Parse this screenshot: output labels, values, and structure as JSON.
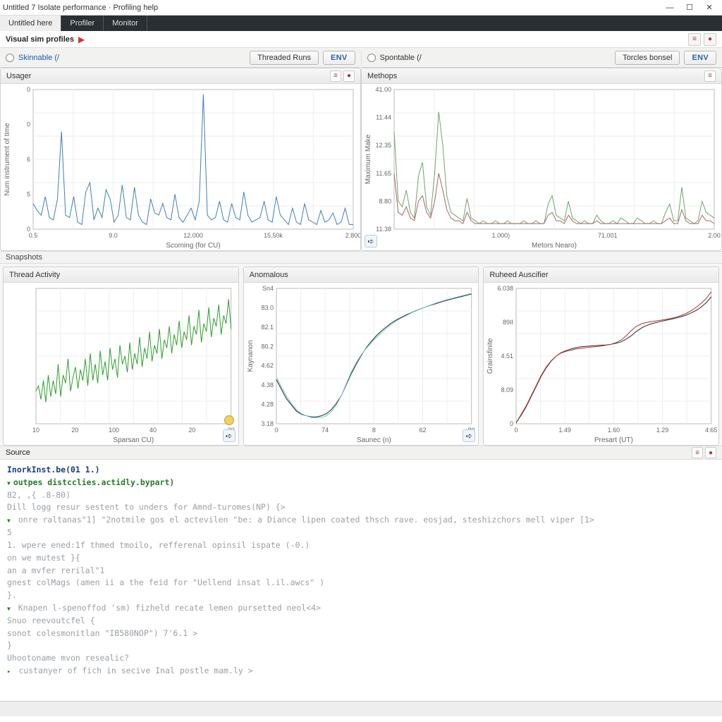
{
  "window": {
    "title": "Untitled 7 Isolate performance · Profiling help"
  },
  "tabs": [
    {
      "label": "Untitled here",
      "active": true
    },
    {
      "label": "Profiler",
      "active": false
    },
    {
      "label": "Monitor",
      "active": false
    }
  ],
  "subheader": {
    "title": "Visual sim profiles"
  },
  "controls": {
    "left": {
      "radio_label": "Skinnable (/",
      "btn1": "Threaded Runs",
      "btn2": "ENV"
    },
    "right": {
      "radio_label": "Spontable (/",
      "btn1": "Torcles bonsel",
      "btn2": "ENV"
    }
  },
  "panel_titles": {
    "p1": "Usager",
    "p2": "Methops",
    "mid_label": "Snapshots",
    "p3": "Thread Activity",
    "p4": "Anomalous",
    "p5": "Ruheed Auscifier"
  },
  "source_bar": {
    "label": "Source"
  },
  "console_lines": [
    {
      "cls": "fn",
      "text": "InorkInst.be(01 1.)"
    },
    {
      "cls": "kw chevron",
      "text": "outpes distcclies.actidly.bypart)"
    },
    {
      "cls": "cm",
      "text": "   82,              ,{ .8-80)"
    },
    {
      "cls": "cm",
      "text": "   Dill logg resur sestent to unders for Amnd-turomes(NP) {>"
    },
    {
      "cls": "cm chevron",
      "text": " onre raltanas\"1] \"2notmile gos el actevilen \"be: a Diance lipen coated thsch rave. eosjad, steshizchors mell viper [1>"
    },
    {
      "cls": "cm",
      "text": "   5"
    },
    {
      "cls": "cm",
      "text": "   1. wpere ened:1f thmed tmoilo, refferenal opinsil ispate (-0.)"
    },
    {
      "cls": "cm",
      "text": "      on we mutest }{"
    },
    {
      "cls": "cm",
      "text": "      an a mvfer rerilal\"1"
    },
    {
      "cls": "cm",
      "text": "         gnest colMags (amen ii a the feid for \"Uellend insat l.il.awcs\" )"
    },
    {
      "cls": "cm",
      "text": "   }."
    },
    {
      "cls": "cm chevron",
      "text": " Knapen l-spenoffod 'sm) fizheld recate lemen pursetted neol<4>"
    },
    {
      "cls": "cm",
      "text": "   Snuo reevoutcfel {"
    },
    {
      "cls": "cm",
      "text": "   sonot colesmonitlan \"IB580NOP\") 7'6.1 >"
    },
    {
      "cls": "cm",
      "text": "   }"
    },
    {
      "cls": "cm",
      "text": "   Uhootoname mvon resealic?"
    },
    {
      "cls": "cm chevronr",
      "text": " custanyer of fich in secive Inal postle mam.ly >"
    }
  ],
  "chart_data": [
    {
      "id": "p1",
      "type": "line",
      "title": "Usager",
      "xlabel": "Scoming (for CU)",
      "ylabel": "Num instrument of time",
      "xticks": [
        "0.5",
        "9.0",
        "12.000",
        "15.50k",
        "2.800"
      ],
      "yticks": [
        "0",
        "5",
        "6",
        "0",
        "0"
      ],
      "series": [
        {
          "name": "trace-blue",
          "color": "#3f7fbf",
          "values": [
            1.1,
            0.8,
            0.6,
            1.4,
            0.5,
            0.4,
            1.3,
            4.2,
            0.6,
            0.5,
            1.4,
            0.3,
            0.2,
            1.6,
            2.0,
            0.4,
            0.9,
            0.5,
            1.7,
            1.3,
            0.3,
            0.6,
            1.9,
            0.5,
            0.4,
            1.8,
            0.6,
            0.3,
            0.2,
            1.3,
            0.7,
            0.6,
            1.1,
            0.5,
            0.4,
            1.5,
            0.5,
            0.3,
            0.6,
            0.9,
            0.4,
            1.2,
            5.8,
            0.6,
            0.4,
            0.5,
            1.2,
            0.4,
            0.3,
            1.1,
            0.5,
            0.4,
            1.6,
            0.6,
            0.3,
            0.4,
            0.5,
            1.2,
            0.4,
            0.3,
            1.4,
            0.6,
            0.4,
            0.2,
            0.9,
            0.3,
            0.2,
            1.1,
            0.4,
            0.3,
            0.2,
            0.8,
            0.3,
            0.4,
            0.7,
            0.2,
            0.3,
            0.9,
            0.2,
            0.2
          ]
        }
      ],
      "ylim": [
        0,
        6
      ]
    },
    {
      "id": "p2",
      "type": "line",
      "title": "Methops",
      "xlabel": "Metors Nearo)",
      "ylabel": "Maximum Make",
      "xticks": [
        "",
        "1.000)",
        "71.001",
        "2.00"
      ],
      "yticks": [
        "11.38",
        "8.80",
        "11.65",
        "12.35",
        "11.44",
        "41.00"
      ],
      "series": [
        {
          "name": "trace-a",
          "color": "#6fa36f",
          "values": [
            3.5,
            1.0,
            0.8,
            1.4,
            0.6,
            0.4,
            1.9,
            2.4,
            0.8,
            0.5,
            2.0,
            4.2,
            3.0,
            1.2,
            0.6,
            0.5,
            0.4,
            0.3,
            1.1,
            0.4,
            0.3,
            0.2,
            0.3,
            0.2,
            0.2,
            0.3,
            0.2,
            0.2,
            0.3,
            0.2,
            0.2,
            0.2,
            0.3,
            0.2,
            0.2,
            0.3,
            0.2,
            0.2,
            0.9,
            1.2,
            0.5,
            0.4,
            0.3,
            1.0,
            0.4,
            0.3,
            0.2,
            0.3,
            0.2,
            0.2,
            0.5,
            0.3,
            0.2,
            0.2,
            0.3,
            0.2,
            0.4,
            0.3,
            0.2,
            0.2,
            0.4,
            0.3,
            0.2,
            0.2,
            0.3,
            0.2,
            0.2,
            0.6,
            0.9,
            0.3,
            0.3,
            1.5,
            0.4,
            0.3,
            0.2,
            0.3,
            1.0,
            0.6,
            0.5,
            0.4
          ]
        },
        {
          "name": "trace-b",
          "color": "#a66",
          "values": [
            2.0,
            0.6,
            0.5,
            0.8,
            0.4,
            0.3,
            1.0,
            1.2,
            0.6,
            0.4,
            1.0,
            2.0,
            1.4,
            0.7,
            0.4,
            0.3,
            0.3,
            0.2,
            0.6,
            0.3,
            0.2,
            0.2,
            0.2,
            0.2,
            0.2,
            0.2,
            0.2,
            0.2,
            0.2,
            0.2,
            0.2,
            0.2,
            0.2,
            0.2,
            0.2,
            0.2,
            0.2,
            0.2,
            0.5,
            0.6,
            0.3,
            0.3,
            0.2,
            0.5,
            0.3,
            0.2,
            0.2,
            0.2,
            0.2,
            0.2,
            0.3,
            0.2,
            0.2,
            0.2,
            0.2,
            0.2,
            0.2,
            0.2,
            0.2,
            0.2,
            0.2,
            0.2,
            0.2,
            0.2,
            0.2,
            0.2,
            0.2,
            0.3,
            0.4,
            0.2,
            0.2,
            0.7,
            0.3,
            0.2,
            0.2,
            0.2,
            0.5,
            0.3,
            0.3,
            0.2
          ]
        }
      ],
      "ylim": [
        0,
        5
      ]
    },
    {
      "id": "p3",
      "type": "line",
      "title": "Thread Activity",
      "xlabel": "Sparsan CU)",
      "ylabel": "",
      "xticks": [
        "10",
        "20",
        "100",
        "40",
        "20",
        "20"
      ],
      "series": [
        {
          "name": "green",
          "color": "#2ca02c",
          "values": [
            2.2,
            2.4,
            1.9,
            2.6,
            1.8,
            2.8,
            2.0,
            2.6,
            2.1,
            3.2,
            2.0,
            2.8,
            2.5,
            3.4,
            2.2,
            2.7,
            3.1,
            2.3,
            3.0,
            2.6,
            3.4,
            2.4,
            3.6,
            2.6,
            3.2,
            2.5,
            3.7,
            2.8,
            3.3,
            2.6,
            3.8,
            3.0,
            3.4,
            2.7,
            3.9,
            3.2,
            3.5,
            2.9,
            4.0,
            3.0,
            3.6,
            3.2,
            4.2,
            3.1,
            3.8,
            3.4,
            4.4,
            3.3,
            3.9,
            3.6,
            4.5,
            3.4,
            4.1,
            3.8,
            4.6,
            3.6,
            4.3,
            3.9,
            4.8,
            3.8,
            4.4,
            4.1,
            5.0,
            3.9,
            4.6,
            4.3,
            5.2,
            4.0,
            4.7,
            4.4,
            5.3,
            4.2,
            4.9,
            4.6,
            5.4,
            4.3,
            5.0,
            4.7,
            5.6,
            4.5
          ]
        }
      ],
      "ylim": [
        1,
        6
      ]
    },
    {
      "id": "p4",
      "type": "line",
      "title": "Anomalous",
      "xlabel": "Saunec (n)",
      "ylabel": "Kaynanon",
      "xticks": [
        "0",
        "74",
        "8",
        "62",
        "80"
      ],
      "yticks": [
        "3.18",
        "4.28",
        "4.38",
        "4.62",
        "80.2",
        "82.1",
        "83.0",
        "Sn4"
      ],
      "series": [
        {
          "name": "black",
          "color": "#222",
          "values": [
            4.0,
            3.7,
            3.4,
            3.2,
            3.0,
            2.9,
            2.85,
            2.82,
            2.82,
            2.85,
            2.92,
            3.05,
            3.25,
            3.5,
            3.85,
            4.2,
            4.5,
            4.78,
            5.02,
            5.22,
            5.4,
            5.55,
            5.68,
            5.8,
            5.9,
            5.98,
            6.06,
            6.13,
            6.2,
            6.26,
            6.32,
            6.37,
            6.42,
            6.47,
            6.52,
            6.56,
            6.6,
            6.64,
            6.68,
            6.72
          ]
        },
        {
          "name": "cyan",
          "color": "#6cc",
          "values": [
            4.08,
            3.78,
            3.48,
            3.24,
            3.05,
            2.92,
            2.85,
            2.8,
            2.79,
            2.8,
            2.85,
            2.98,
            3.2,
            3.5,
            3.88,
            4.25,
            4.55,
            4.8,
            5.0,
            5.18,
            5.34,
            5.49,
            5.63,
            5.76,
            5.87,
            5.96,
            6.04,
            6.12,
            6.19,
            6.26,
            6.32,
            6.38,
            6.44,
            6.49,
            6.54,
            6.58,
            6.62,
            6.66,
            6.7,
            6.74
          ]
        }
      ],
      "ylim": [
        2.6,
        6.9
      ]
    },
    {
      "id": "p5",
      "type": "line",
      "title": "Ruheed Auscifier",
      "xlabel": "Presart (UT)",
      "ylabel": "Grainsfinite",
      "xticks": [
        "0",
        "1.49",
        "1.60",
        "1.29",
        "4:65"
      ],
      "yticks": [
        "0",
        "8.09",
        "4.51",
        "89II",
        "6.038"
      ],
      "series": [
        {
          "name": "dark",
          "color": "#2b2b2b",
          "values": [
            0.05,
            0.5,
            1.0,
            1.6,
            2.2,
            2.8,
            3.3,
            3.7,
            4.0,
            4.2,
            4.32,
            4.42,
            4.5,
            4.55,
            4.58,
            4.6,
            4.62,
            4.64,
            4.66,
            4.7,
            4.76,
            4.84,
            5.0,
            5.2,
            5.45,
            5.65,
            5.8,
            5.9,
            5.98,
            6.05,
            6.12,
            6.18,
            6.25,
            6.33,
            6.42,
            6.55,
            6.7,
            6.9,
            7.15,
            7.5
          ]
        },
        {
          "name": "red",
          "color": "#b23030",
          "values": [
            0.05,
            0.55,
            1.05,
            1.65,
            2.25,
            2.85,
            3.35,
            3.72,
            4.0,
            4.18,
            4.28,
            4.35,
            4.42,
            4.46,
            4.5,
            4.53,
            4.56,
            4.59,
            4.64,
            4.7,
            4.8,
            4.95,
            5.2,
            5.5,
            5.75,
            5.9,
            5.98,
            6.03,
            6.08,
            6.12,
            6.17,
            6.23,
            6.3,
            6.4,
            6.52,
            6.68,
            6.88,
            7.12,
            7.4,
            7.8
          ]
        }
      ],
      "ylim": [
        0,
        8
      ]
    }
  ]
}
